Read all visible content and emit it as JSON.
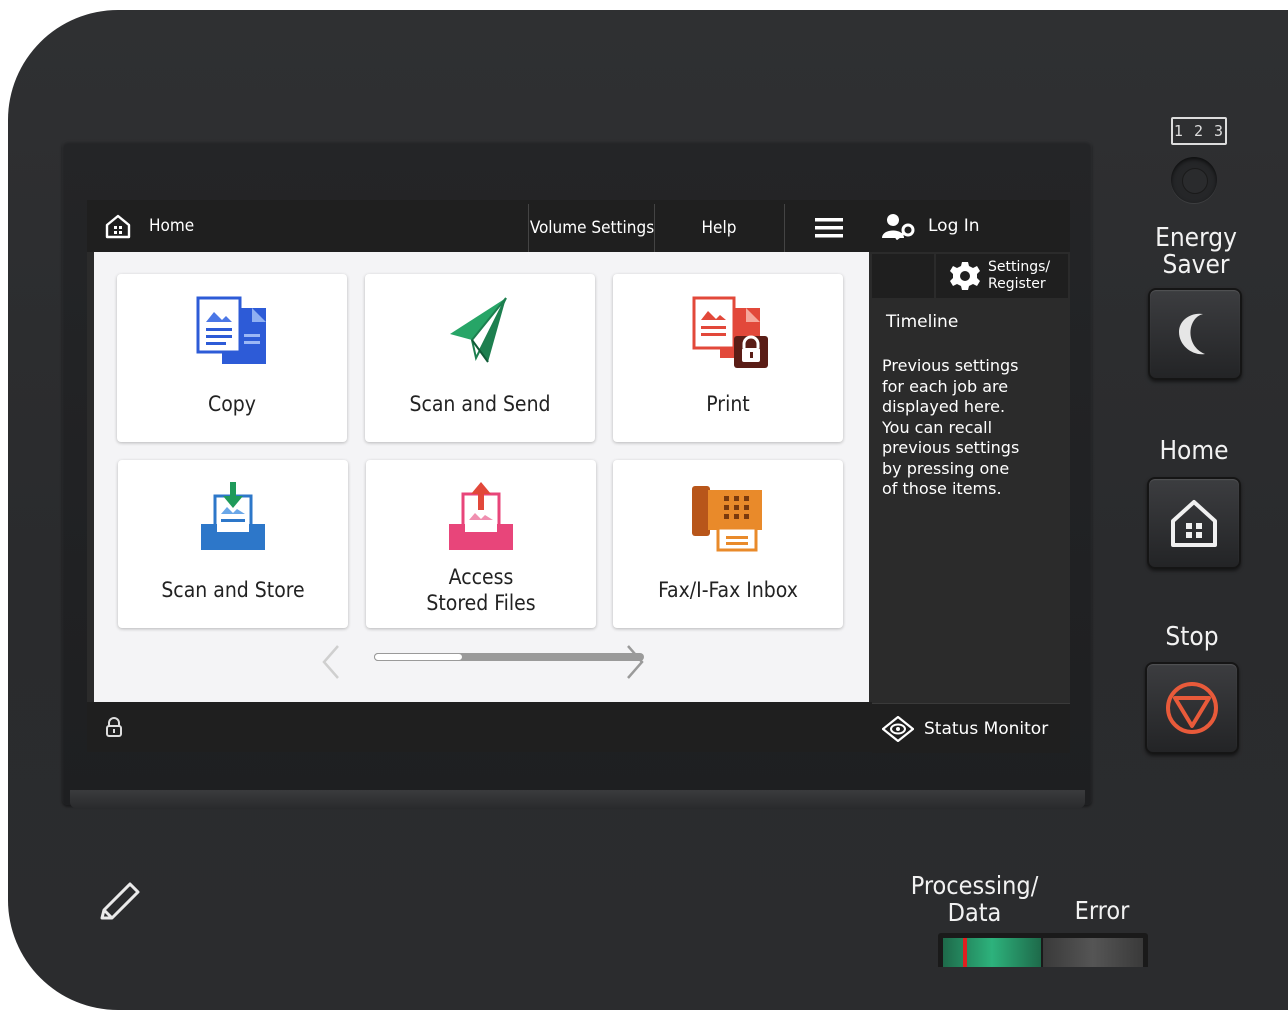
{
  "topbar": {
    "home_label": "Home",
    "volume_settings": "Volume Settings",
    "help": "Help",
    "menu_icon": "hamburger-menu-icon"
  },
  "right_panel": {
    "login_label": "Log In",
    "settings_line1": "Settings/",
    "settings_line2": "Register",
    "timeline_title": "Timeline",
    "timeline_text": "Previous settings\nfor each job are\ndisplayed here.\nYou can recall\nprevious settings\nby pressing one\nof those items.",
    "status_monitor": "Status Monitor"
  },
  "tiles": [
    {
      "label": "Copy",
      "icon": "copy-icon"
    },
    {
      "label": "Scan and Send",
      "icon": "paper-plane-icon"
    },
    {
      "label": "Print",
      "icon": "secure-print-icon"
    },
    {
      "label": "Scan and Store",
      "icon": "scan-store-icon"
    },
    {
      "label_line1": "Access",
      "label_line2": "Stored Files",
      "icon": "access-files-icon"
    },
    {
      "label": "Fax/I-Fax Inbox",
      "icon": "fax-icon"
    }
  ],
  "pager": {
    "page_fraction": 0.33
  },
  "hardware": {
    "counter_label": "1 2 3",
    "energy_saver_line1": "Energy",
    "energy_saver_line2": "Saver",
    "home": "Home",
    "stop": "Stop",
    "processing_line1": "Processing/",
    "processing_line2": "Data",
    "error": "Error"
  },
  "colors": {
    "accent_blue": "#3b6bd9",
    "scan_green": "#1f9a5a",
    "print_red": "#e2483a",
    "stop_red": "#e85a3a",
    "fax_orange": "#e98a2a",
    "access_pink": "#e8457a"
  }
}
